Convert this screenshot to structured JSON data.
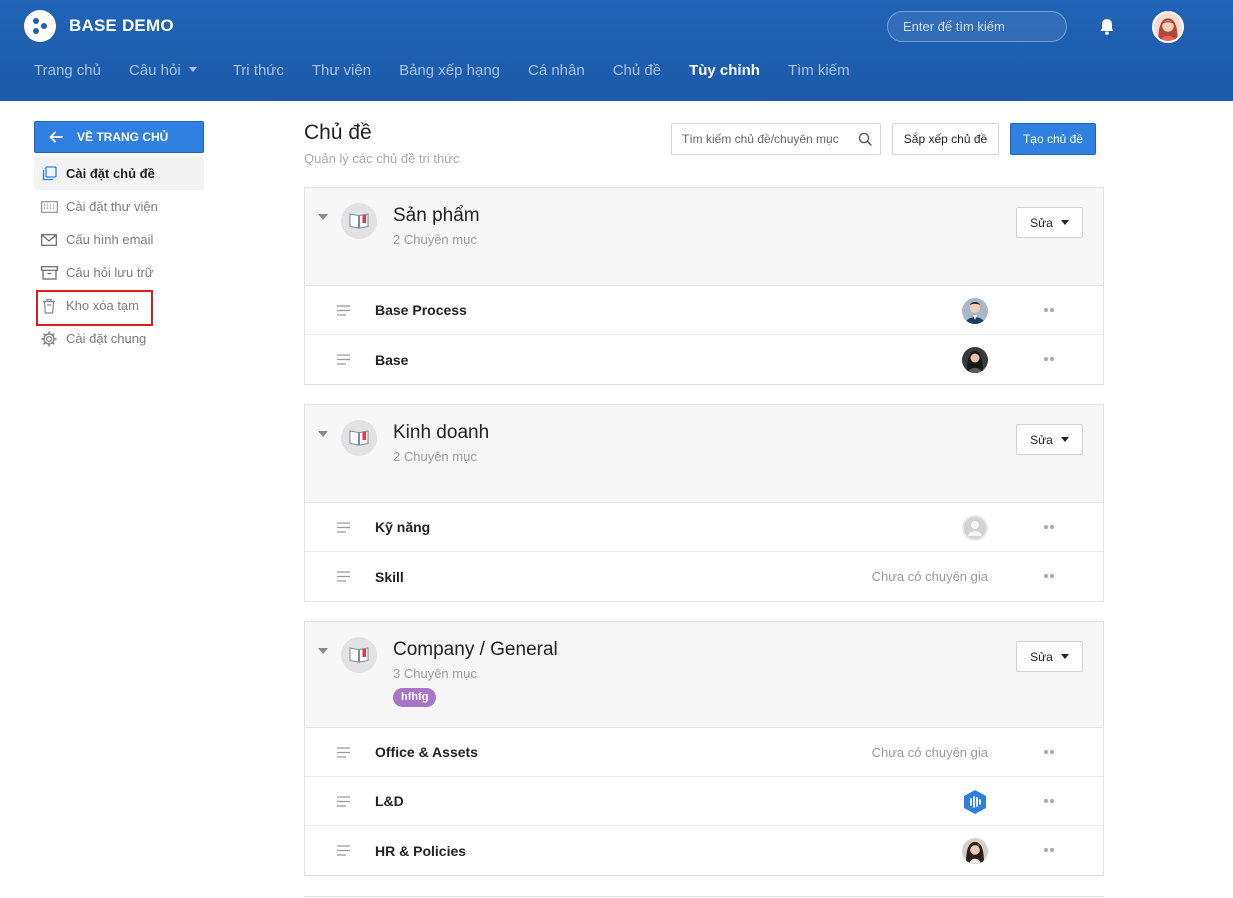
{
  "app": {
    "brand": "BASE DEMO"
  },
  "header": {
    "search_placeholder": "Enter để tìm kiếm",
    "nav": [
      {
        "label": "Trang chủ"
      },
      {
        "label": "Câu hỏi"
      },
      {
        "label": "Tri thức"
      },
      {
        "label": "Thư viện"
      },
      {
        "label": "Bảng xếp hạng"
      },
      {
        "label": "Cá nhân"
      },
      {
        "label": "Chủ đề"
      },
      {
        "label": "Tùy chỉnh",
        "active": true
      },
      {
        "label": "Tìm kiếm"
      }
    ]
  },
  "sidebar": {
    "back_label": "VỀ TRANG CHỦ",
    "items": [
      {
        "label": "Cài đặt chủ đề",
        "icon": "copy-icon",
        "active": true
      },
      {
        "label": "Cài đặt thư viện",
        "icon": "keyboard-icon"
      },
      {
        "label": "Cấu hình email",
        "icon": "mail-icon"
      },
      {
        "label": "Câu hỏi lưu trữ",
        "icon": "archive-icon"
      },
      {
        "label": "Kho xóa tạm",
        "icon": "trash-icon",
        "highlighted": true
      },
      {
        "label": "Cài đặt chung",
        "icon": "gear-icon"
      }
    ]
  },
  "main": {
    "title": "Chủ đề",
    "subtitle": "Quản lý các chủ đề tri thức",
    "search_placeholder": "Tìm kiếm chủ đề/chuyên mục",
    "sort_label": "Sắp xếp chủ đề",
    "create_label": "Tạo chủ đề",
    "edit_label": "Sửa",
    "topics": [
      {
        "name": "Sản phẩm",
        "count": "2 Chuyên mục",
        "categories": [
          {
            "name": "Base Process",
            "expert": "avatar-man"
          },
          {
            "name": "Base",
            "expert": "avatar-woman-dark"
          }
        ]
      },
      {
        "name": "Kinh doanh",
        "count": "2 Chuyên mục",
        "categories": [
          {
            "name": "Kỹ năng",
            "expert": "avatar-placeholder"
          },
          {
            "name": "Skill",
            "no_expert": "Chưa có chuyên gia"
          }
        ]
      },
      {
        "name": "Company / General",
        "count": "3 Chuyên mục",
        "tag": "hfhfg",
        "categories": [
          {
            "name": "Office & Assets",
            "no_expert": "Chưa có chuyên gia"
          },
          {
            "name": "L&D",
            "expert": "avatar-logo-blue"
          },
          {
            "name": "HR & Policies",
            "expert": "avatar-woman"
          }
        ]
      }
    ]
  },
  "colors": {
    "header_blue": "#1f5fb0",
    "primary_button": "#2f80e0",
    "tag_purple": "#a974c7",
    "highlight_red": "#e21b1b"
  }
}
